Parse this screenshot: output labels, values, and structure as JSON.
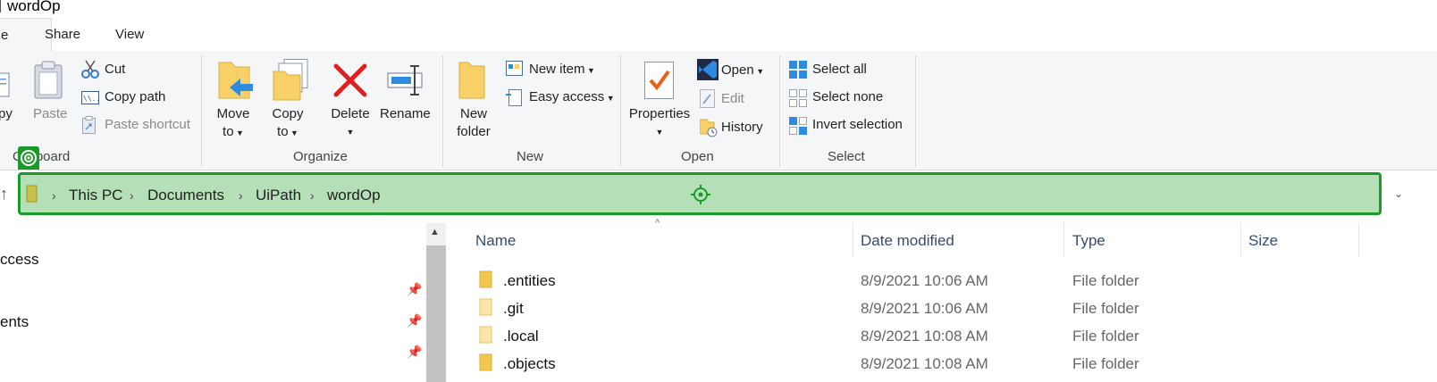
{
  "window": {
    "title": "wordOp"
  },
  "tabs": [
    {
      "label": "e",
      "active": true
    },
    {
      "label": "Share",
      "active": false
    },
    {
      "label": "View",
      "active": false
    }
  ],
  "ribbon": {
    "clipboard": {
      "group_label": "Clipboard",
      "copy_label": "py",
      "paste_label": "Paste",
      "cut_label": "Cut",
      "copy_path_label": "Copy path",
      "paste_shortcut_label": "Paste shortcut"
    },
    "organize": {
      "group_label": "Organize",
      "move_to_line1": "Move",
      "move_to_line2": "to",
      "copy_to_line1": "Copy",
      "copy_to_line2": "to",
      "delete_label": "Delete",
      "rename_label": "Rename"
    },
    "new": {
      "group_label": "New",
      "new_folder_line1": "New",
      "new_folder_line2": "folder",
      "new_item_label": "New item",
      "easy_access_label": "Easy access"
    },
    "open": {
      "group_label": "Open",
      "properties_label": "Properties",
      "open_label": "Open",
      "edit_label": "Edit",
      "history_label": "History"
    },
    "select": {
      "group_label": "Select",
      "select_all_label": "Select all",
      "select_none_label": "Select none",
      "invert_selection_label": "Invert selection"
    }
  },
  "address": {
    "crumbs": [
      "This PC",
      "Documents",
      "UiPath",
      "wordOp"
    ]
  },
  "nav_pane": {
    "items": [
      "ccess",
      "ents"
    ]
  },
  "file_list": {
    "columns": {
      "name": "Name",
      "date": "Date modified",
      "type": "Type",
      "size": "Size"
    },
    "rows": [
      {
        "name": ".entities",
        "date": "8/9/2021 10:06 AM",
        "type": "File folder"
      },
      {
        "name": ".git",
        "date": "8/9/2021 10:06 AM",
        "type": "File folder"
      },
      {
        "name": ".local",
        "date": "8/9/2021 10:08 AM",
        "type": "File folder"
      },
      {
        "name": ".objects",
        "date": "8/9/2021 10:08 AM",
        "type": "File folder"
      }
    ]
  },
  "colors": {
    "accent_green": "#1a9a28",
    "address_highlight": "#b5dfb7",
    "folder_yellow": "#f3c74d"
  },
  "icons": [
    "folder-icon",
    "cut-icon",
    "copy-path-icon",
    "paste-shortcut-icon",
    "paste-icon",
    "move-to-icon",
    "copy-to-icon",
    "delete-icon",
    "rename-icon",
    "new-item-icon",
    "easy-access-icon",
    "properties-icon",
    "vscode-open-icon",
    "edit-icon",
    "history-icon",
    "select-all-icon",
    "select-none-icon",
    "invert-selection-icon",
    "pin-icon",
    "up-arrow-icon",
    "chevron-right-icon",
    "crosshair-icon",
    "target-icon"
  ]
}
